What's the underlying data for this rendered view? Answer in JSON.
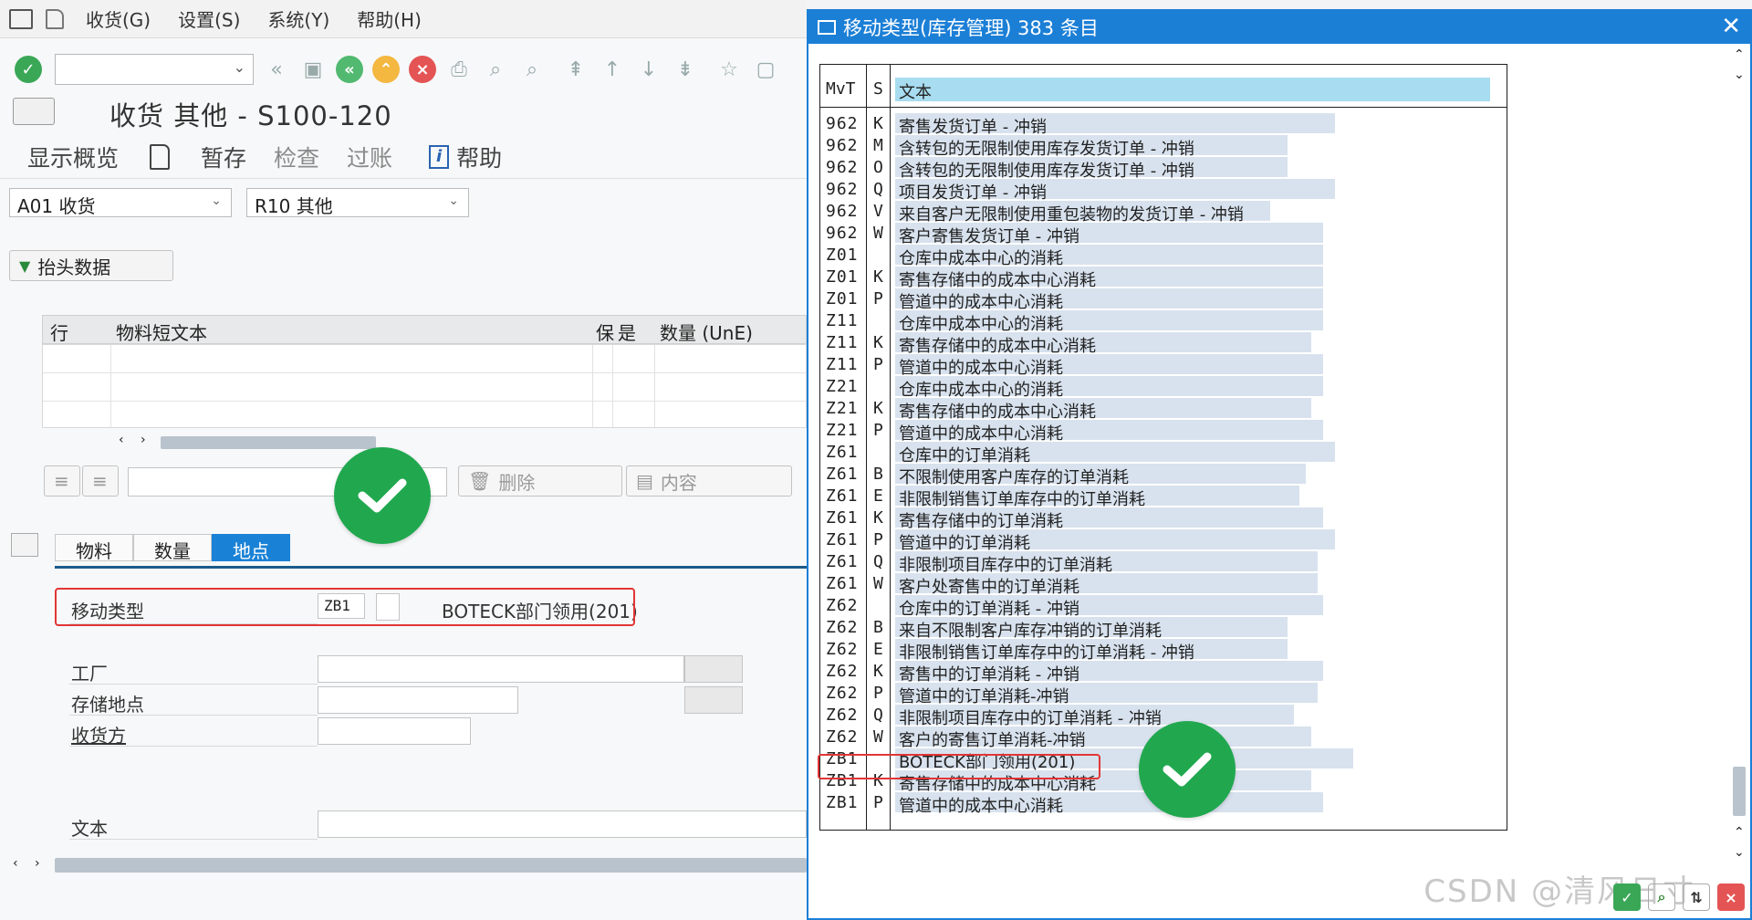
{
  "menu": {
    "items": [
      "收货(G)",
      "设置(S)",
      "系统(Y)",
      "帮助(H)"
    ]
  },
  "page": {
    "title": "收货 其他 - S100-120"
  },
  "appbar": {
    "overview": "显示概览",
    "hold": "暂存",
    "check": "检查",
    "post": "过账",
    "help": "帮助"
  },
  "selectors": {
    "action": "A01 收货",
    "reference": "R10 其他"
  },
  "header_button": "抬头数据",
  "grid": {
    "columns": [
      "行",
      "物料短文本",
      "保",
      "是",
      "数量 (UnE)"
    ]
  },
  "item_buttons": {
    "delete": "删除",
    "contents": "内容"
  },
  "tabs": [
    "物料",
    "数量",
    "地点"
  ],
  "detail": {
    "movement_type_label": "移动类型",
    "movement_type_value": "ZB1",
    "movement_type_desc": "BOTECK部门领用(201)",
    "plant_label": "工厂",
    "sloc_label": "存储地点",
    "recipient_label": "收货方",
    "text_label": "文本"
  },
  "popup": {
    "title": "移动类型(库存管理) 383 条目",
    "headers": {
      "mvt": "MvT",
      "s": "S",
      "text": "文本"
    },
    "rows": [
      {
        "mvt": "962",
        "s": "K",
        "text": "寄售发货订单 - 冲销",
        "w": 0.74
      },
      {
        "mvt": "962",
        "s": "M",
        "text": "含转包的无限制使用库存发货订单 - 冲销",
        "w": 0.66
      },
      {
        "mvt": "962",
        "s": "O",
        "text": "含转包的无限制使用库存发货订单 - 冲销",
        "w": 0.66
      },
      {
        "mvt": "962",
        "s": "Q",
        "text": "项目发货订单 - 冲销",
        "w": 0.74
      },
      {
        "mvt": "962",
        "s": "V",
        "text": "来自客户无限制使用重包装物的发货订单 - 冲销",
        "w": 0.63
      },
      {
        "mvt": "962",
        "s": "W",
        "text": "客户寄售发货订单 - 冲销",
        "w": 0.72
      },
      {
        "mvt": "Z01",
        "s": "",
        "text": "仓库中成本中心的消耗",
        "w": 0.72
      },
      {
        "mvt": "Z01",
        "s": "K",
        "text": "寄售存储中的成本中心消耗",
        "w": 0.72
      },
      {
        "mvt": "Z01",
        "s": "P",
        "text": "管道中的成本中心消耗",
        "w": 0.72
      },
      {
        "mvt": "Z11",
        "s": "",
        "text": "仓库中成本中心的消耗",
        "w": 0.72
      },
      {
        "mvt": "Z11",
        "s": "K",
        "text": "寄售存储中的成本中心消耗",
        "w": 0.7
      },
      {
        "mvt": "Z11",
        "s": "P",
        "text": "管道中的成本中心消耗",
        "w": 0.72
      },
      {
        "mvt": "Z21",
        "s": "",
        "text": "仓库中成本中心的消耗",
        "w": 0.72
      },
      {
        "mvt": "Z21",
        "s": "K",
        "text": "寄售存储中的成本中心消耗",
        "w": 0.7
      },
      {
        "mvt": "Z21",
        "s": "P",
        "text": "管道中的成本中心消耗",
        "w": 0.72
      },
      {
        "mvt": "Z61",
        "s": "",
        "text": "仓库中的订单消耗",
        "w": 0.74
      },
      {
        "mvt": "Z61",
        "s": "B",
        "text": "不限制使用客户库存的订单消耗",
        "w": 0.69
      },
      {
        "mvt": "Z61",
        "s": "E",
        "text": "非限制销售订单库存中的订单消耗",
        "w": 0.68
      },
      {
        "mvt": "Z61",
        "s": "K",
        "text": "寄售存储中的订单消耗",
        "w": 0.72
      },
      {
        "mvt": "Z61",
        "s": "P",
        "text": "管道中的订单消耗",
        "w": 0.74
      },
      {
        "mvt": "Z61",
        "s": "Q",
        "text": "非限制项目库存中的订单消耗",
        "w": 0.71
      },
      {
        "mvt": "Z61",
        "s": "W",
        "text": "客户处寄售中的订单消耗",
        "w": 0.71
      },
      {
        "mvt": "Z62",
        "s": "",
        "text": "仓库中的订单消耗 - 冲销",
        "w": 0.72
      },
      {
        "mvt": "Z62",
        "s": "B",
        "text": "来自不限制客户库存冲销的订单消耗",
        "w": 0.66
      },
      {
        "mvt": "Z62",
        "s": "E",
        "text": "非限制销售订单库存中的订单消耗 - 冲销",
        "w": 0.66
      },
      {
        "mvt": "Z62",
        "s": "K",
        "text": "寄售中的订单消耗 - 冲销",
        "w": 0.72
      },
      {
        "mvt": "Z62",
        "s": "P",
        "text": "管道中的订单消耗-冲销",
        "w": 0.71
      },
      {
        "mvt": "Z62",
        "s": "Q",
        "text": "非限制项目库存中的订单消耗 - 冲销",
        "w": 0.67
      },
      {
        "mvt": "Z62",
        "s": "W",
        "text": "客户的寄售订单消耗-冲销",
        "w": 0.7
      },
      {
        "mvt": "ZB1",
        "s": "",
        "text": "BOTECK部门领用(201)",
        "w": 0.77
      },
      {
        "mvt": "ZB1",
        "s": "K",
        "text": "寄售存储中的成本中心消耗",
        "w": 0.7
      },
      {
        "mvt": "ZB1",
        "s": "P",
        "text": "管道中的成本中心消耗",
        "w": 0.72
      }
    ]
  },
  "watermark": "CSDN @清风日寸",
  "colors": {
    "accent": "#1c7fd6",
    "highlight_red": "#e23535",
    "check_green": "#21a84f",
    "row_bg": "#d8e2ee",
    "header_bg": "#a8dcf0"
  }
}
